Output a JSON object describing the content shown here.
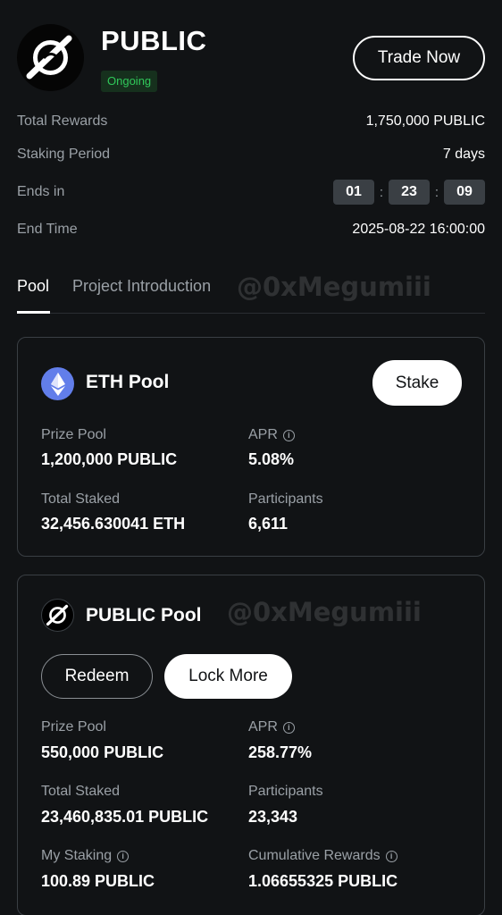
{
  "header": {
    "title": "PUBLIC",
    "status": "Ongoing",
    "trade_button": "Trade Now",
    "logo_icon": "public-token-logo"
  },
  "info": {
    "total_rewards_label": "Total Rewards",
    "total_rewards_value": "1,750,000 PUBLIC",
    "staking_period_label": "Staking Period",
    "staking_period_value": "7 days",
    "ends_in_label": "Ends in",
    "timer_hours": "01",
    "timer_minutes": "23",
    "timer_seconds": "09",
    "timer_separator": ":",
    "end_time_label": "End Time",
    "end_time_value": "2025-08-22 16:00:00"
  },
  "tabs": [
    {
      "label": "Pool",
      "active": true
    },
    {
      "label": "Project Introduction",
      "active": false
    }
  ],
  "watermark": "@0xMegumiii",
  "eth_pool": {
    "name": "ETH Pool",
    "stake_button": "Stake",
    "prize_pool_label": "Prize Pool",
    "prize_pool_value": "1,200,000 PUBLIC",
    "apr_label": "APR",
    "apr_value": "5.08%",
    "total_staked_label": "Total Staked",
    "total_staked_value": "32,456.630041 ETH",
    "participants_label": "Participants",
    "participants_value": "6,611"
  },
  "public_pool": {
    "name": "PUBLIC Pool",
    "redeem_button": "Redeem",
    "lock_more_button": "Lock More",
    "prize_pool_label": "Prize Pool",
    "prize_pool_value": "550,000 PUBLIC",
    "apr_label": "APR",
    "apr_value": "258.77%",
    "total_staked_label": "Total Staked",
    "total_staked_value": "23,460,835.01 PUBLIC",
    "participants_label": "Participants",
    "participants_value": "23,343",
    "my_staking_label": "My Staking",
    "my_staking_value": "100.89 PUBLIC",
    "cumulative_rewards_label": "Cumulative Rewards",
    "cumulative_rewards_value": "1.06655325 PUBLIC"
  },
  "colors": {
    "background": "#111315",
    "status_green": "#30c85a",
    "eth_blue": "#627eea",
    "muted_text": "#9aa0a6"
  }
}
